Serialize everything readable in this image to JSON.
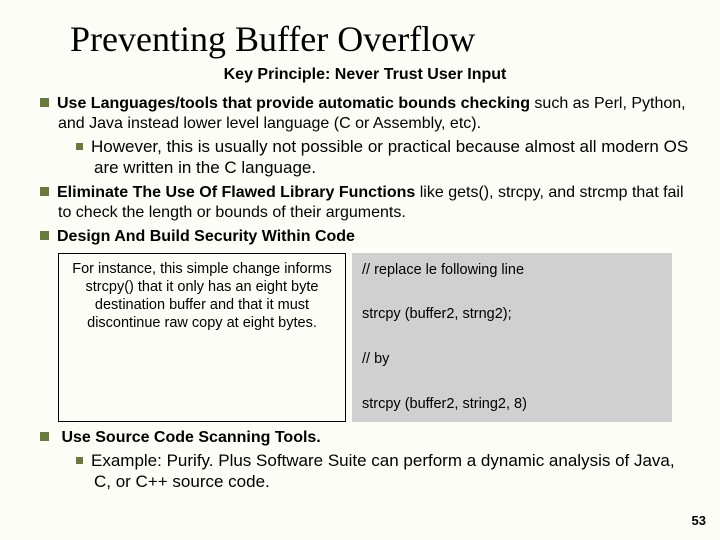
{
  "title": "Preventing Buffer Overflow",
  "subtitle": "Key Principle: Never Trust User Input",
  "bullets": {
    "b1_lead": "Use Languages/tools that provide automatic bounds checking",
    "b1_rest": " such as Perl, Python, and Java instead lower level language (C or Assembly, etc).",
    "b1_sub": "However, this is usually not possible or practical because almost all modern OS are written in the C language.",
    "b2_lead": "Eliminate The Use Of Flawed Library Functions",
    "b2_rest": " like gets(), strcpy, and strcmp that fail to check the length or bounds of their arguments.",
    "b3": "Design And Build Security Within Code",
    "b4": " Use Source Code Scanning Tools.",
    "b4_sub": "Example: Purify. Plus Software Suite can perform a dynamic analysis of Java, C, or C++ source code."
  },
  "leftbox": "For instance, this simple change informs strcpy() that it only has an eight byte destination buffer and that it must discontinue raw copy at eight bytes.",
  "rightbox": "// replace le following line\n\nstrcpy (buffer2, strng2);\n\n// by\n\nstrcpy (buffer2, string2, 8)",
  "pagenum": "53"
}
